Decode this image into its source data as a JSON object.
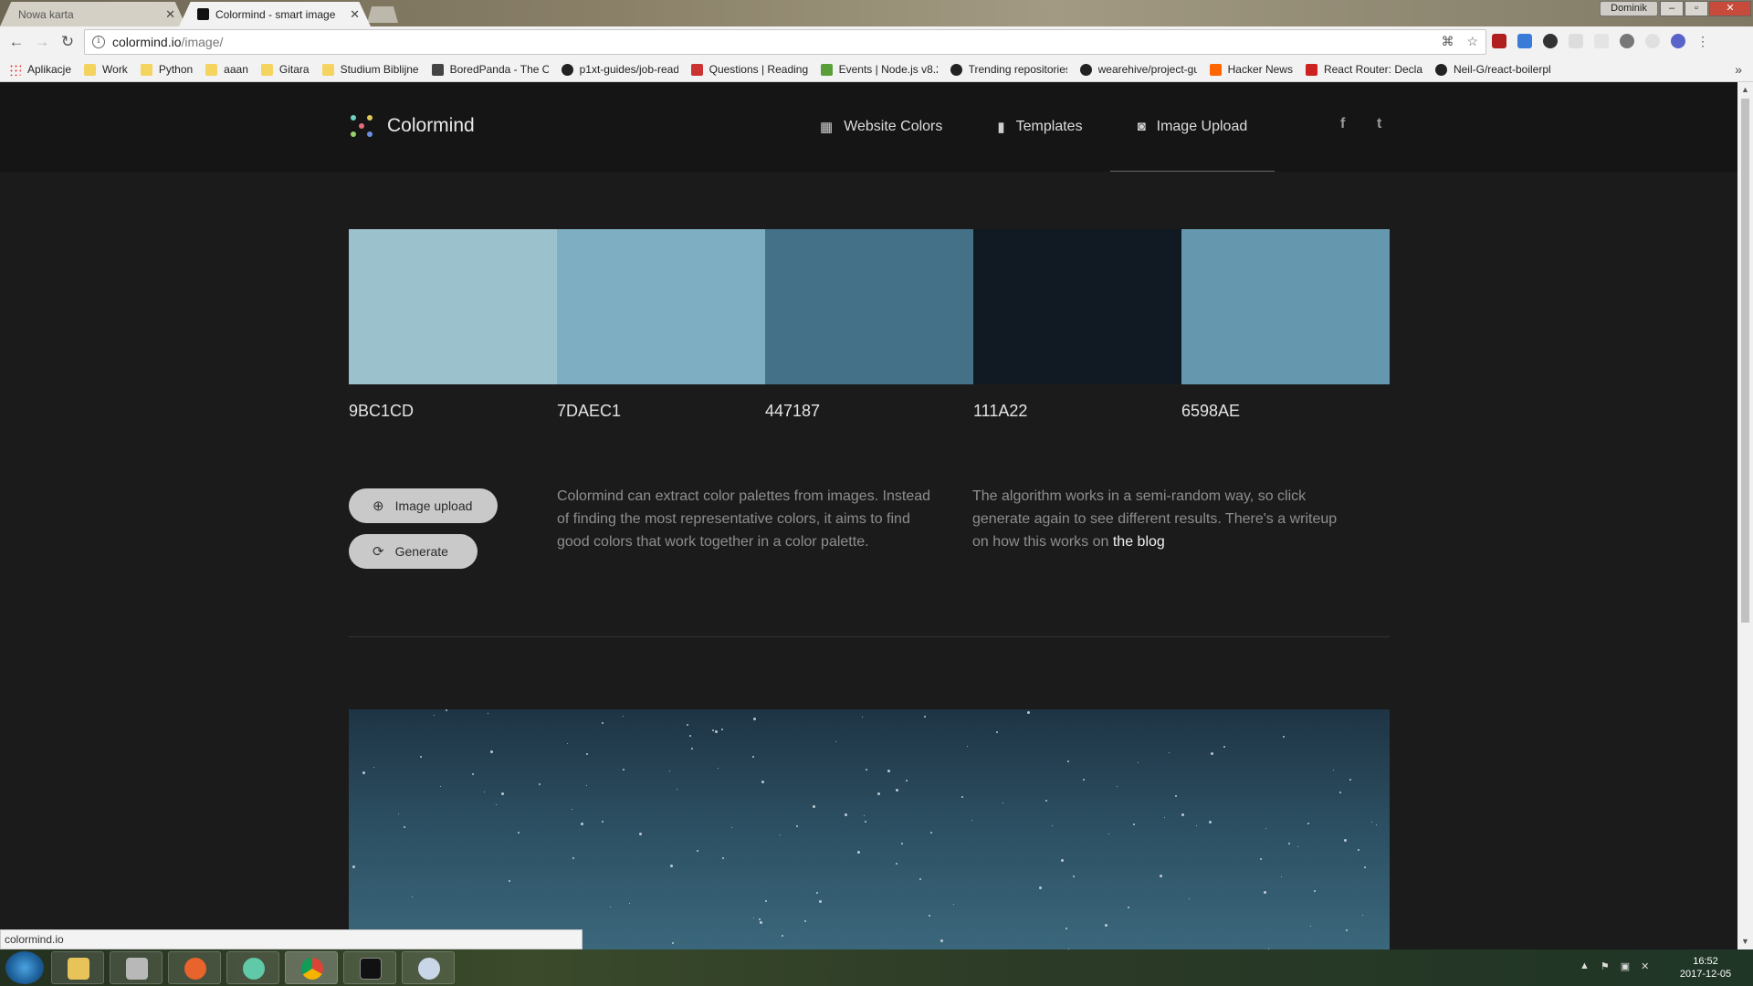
{
  "browser": {
    "tabs": [
      {
        "title": "Nowa karta",
        "active": false
      },
      {
        "title": "Colormind - smart image",
        "active": true
      }
    ],
    "profile": "Dominik",
    "url_host": "colormind.io",
    "url_path": "/image/",
    "bookmarks": [
      {
        "label": "Aplikacje",
        "icon": "apps-icon"
      },
      {
        "label": "Work",
        "icon": "folder-icon"
      },
      {
        "label": "Python",
        "icon": "folder-icon"
      },
      {
        "label": "aaan",
        "icon": "folder-icon"
      },
      {
        "label": "Gitara",
        "icon": "folder-icon"
      },
      {
        "label": "Studium Biblijne",
        "icon": "folder-icon"
      },
      {
        "label": "BoredPanda - The Or",
        "icon": "boredpanda-icon"
      },
      {
        "label": "p1xt-guides/job-read",
        "icon": "github-icon"
      },
      {
        "label": "Questions | Reading",
        "icon": "edx-icon"
      },
      {
        "label": "Events | Node.js v8.2",
        "icon": "nodejs-icon"
      },
      {
        "label": "Trending repositories",
        "icon": "github-icon"
      },
      {
        "label": "wearehive/project-gu",
        "icon": "github-icon"
      },
      {
        "label": "Hacker News",
        "icon": "hackernews-icon"
      },
      {
        "label": "React Router: Declara",
        "icon": "reactrouter-icon"
      },
      {
        "label": "Neil-G/react-boilerpl",
        "icon": "github-icon"
      }
    ],
    "status_text": "colormind.io"
  },
  "site": {
    "logo_text": "Colormind",
    "nav": [
      {
        "label": "Website Colors",
        "icon": "grid-icon",
        "active": false
      },
      {
        "label": "Templates",
        "icon": "bookmark-icon",
        "active": false
      },
      {
        "label": "Image Upload",
        "icon": "camera-icon",
        "active": true
      }
    ],
    "social": [
      {
        "icon": "facebook-icon",
        "glyph": "f"
      },
      {
        "icon": "twitter-icon",
        "glyph": "t"
      }
    ],
    "palette": [
      {
        "hex": "9BC1CD",
        "color": "#9BC1CD"
      },
      {
        "hex": "7DAEC1",
        "color": "#7DAEC1"
      },
      {
        "hex": "447187",
        "color": "#447187"
      },
      {
        "hex": "111A22",
        "color": "#111A22"
      },
      {
        "hex": "6598AE",
        "color": "#6598AE"
      }
    ],
    "buttons": {
      "upload_label": "Image upload",
      "generate_label": "Generate"
    },
    "description_left": "Colormind can extract color palettes from images. Instead of finding the most representative colors, it aims to find good colors that work together in a color palette.",
    "description_right_prefix": "The algorithm works in a semi-random way, so click generate again to see different results. There's a writeup on how this works on ",
    "description_right_link": "the blog"
  },
  "taskbar": {
    "clock_time": "16:52",
    "clock_date": "2017-12-05"
  }
}
